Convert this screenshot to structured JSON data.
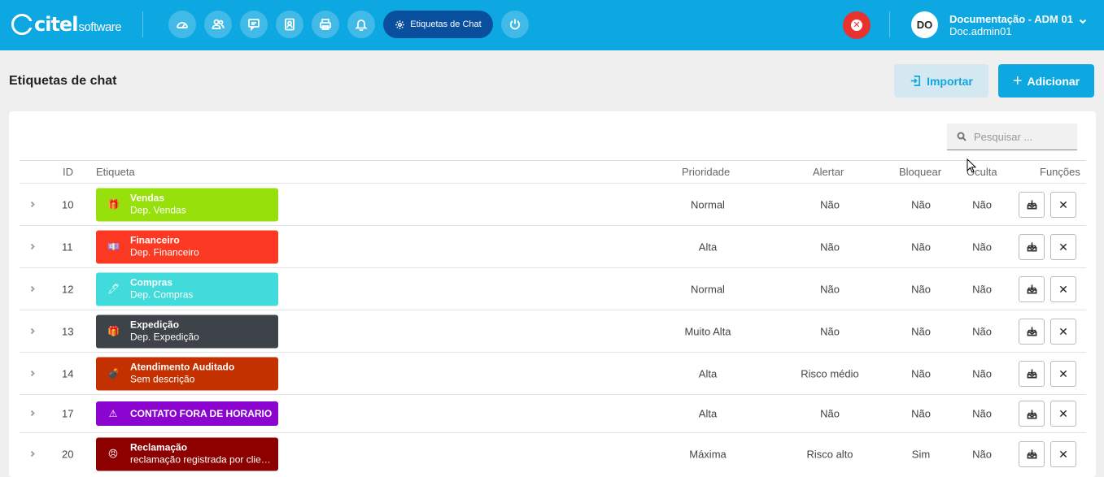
{
  "header": {
    "logo_text": "citel",
    "logo_sub": "software",
    "active_tab_label": "Etiquetas de Chat",
    "user_initials": "DO",
    "user_name": "Documentação - ADM 01",
    "user_login": "Doc.admin01",
    "nav_icons": [
      "dashboard-icon",
      "users-icon",
      "chat-icon",
      "contacts-icon",
      "printer-icon",
      "bell-icon"
    ],
    "power_icon": "power-icon",
    "close_icon": "close-circle-icon"
  },
  "page": {
    "title": "Etiquetas de chat",
    "import_label": "Importar",
    "add_label": "Adicionar",
    "search_placeholder": "Pesquisar ..."
  },
  "table": {
    "columns": [
      "ID",
      "Etiqueta",
      "Prioridade",
      "Alertar",
      "Bloquear",
      "Oculta",
      "Funções"
    ],
    "rows": [
      {
        "id": "10",
        "title": "Vendas",
        "desc": "Dep. Vendas",
        "emoji": "🎁",
        "color": "#97e00c",
        "prioridade": "Normal",
        "alertar": "Não",
        "bloquear": "Não",
        "oculta": "Não"
      },
      {
        "id": "11",
        "title": "Financeiro",
        "desc": "Dep. Financeiro",
        "emoji": "💷",
        "color": "#fc3a23",
        "prioridade": "Alta",
        "alertar": "Não",
        "bloquear": "Não",
        "oculta": "Não"
      },
      {
        "id": "12",
        "title": "Compras",
        "desc": "Dep. Compras",
        "emoji": "🖊",
        "color": "#40dbda",
        "prioridade": "Normal",
        "alertar": "Não",
        "bloquear": "Não",
        "oculta": "Não"
      },
      {
        "id": "13",
        "title": "Expedição",
        "desc": "Dep. Expedição",
        "emoji": "🎁",
        "color": "#3d4349",
        "prioridade": "Muito Alta",
        "alertar": "Não",
        "bloquear": "Não",
        "oculta": "Não"
      },
      {
        "id": "14",
        "title": "Atendimento Auditado",
        "desc": "Sem descrição",
        "emoji": "💣",
        "color": "#c33100",
        "prioridade": "Alta",
        "alertar": "Risco médio",
        "bloquear": "Não",
        "oculta": "Não"
      },
      {
        "id": "17",
        "title": "CONTATO FORA DE HORARIO",
        "desc": "",
        "emoji": "⚠",
        "color": "#8c04d0",
        "prioridade": "Alta",
        "alertar": "Não",
        "bloquear": "Não",
        "oculta": "Não"
      },
      {
        "id": "20",
        "title": "Reclamação",
        "desc": "reclamação registrada por cliente",
        "emoji": "😠",
        "color": "#8d0000",
        "prioridade": "Máxima",
        "alertar": "Risco alto",
        "bloquear": "Sim",
        "oculta": "Não"
      }
    ],
    "row_actions": [
      "tray-download-icon",
      "close-icon"
    ]
  }
}
